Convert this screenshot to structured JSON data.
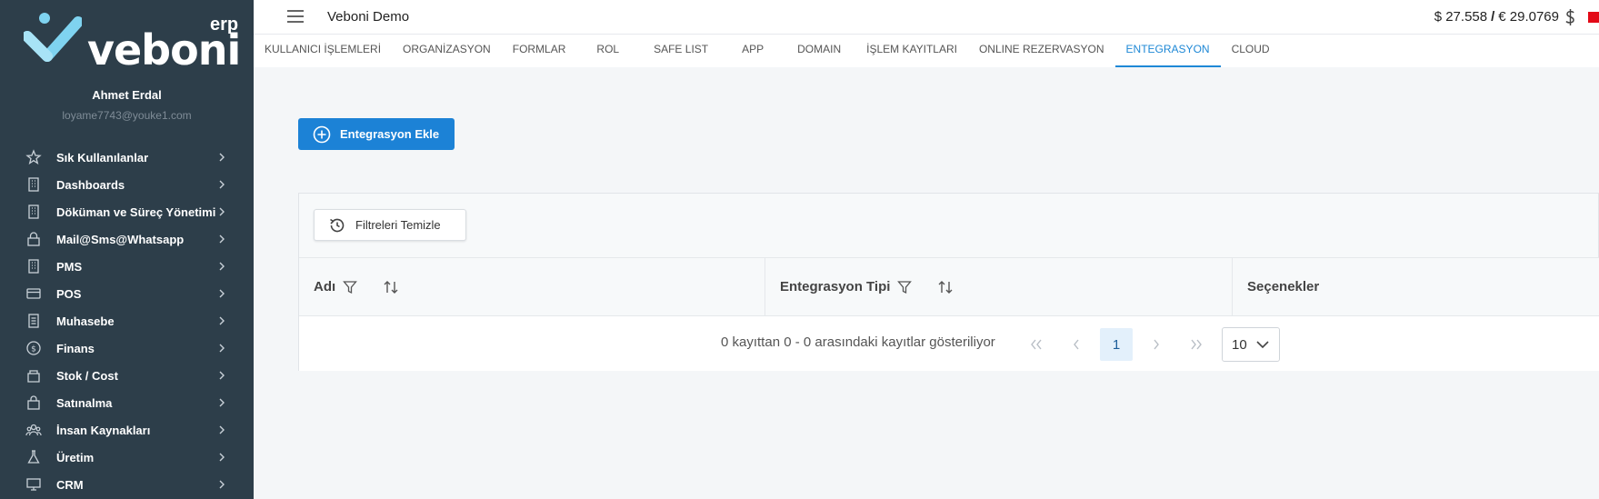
{
  "brand": {
    "logo_text": "veboni",
    "logo_suffix": "erp"
  },
  "user": {
    "name": "Ahmet Erdal",
    "email": "loyame7743@youke1.com"
  },
  "sidebar": {
    "items": [
      {
        "label": "Sık Kullanılanlar",
        "icon": "star-icon"
      },
      {
        "label": "Dashboards",
        "icon": "building-icon"
      },
      {
        "label": "Döküman ve Süreç Yönetimi",
        "icon": "building-icon"
      },
      {
        "label": "Mail@Sms@Whatsapp",
        "icon": "lock-icon"
      },
      {
        "label": "PMS",
        "icon": "building-icon"
      },
      {
        "label": "POS",
        "icon": "card-icon"
      },
      {
        "label": "Muhasebe",
        "icon": "ledger-icon"
      },
      {
        "label": "Finans",
        "icon": "dollar-circle-icon"
      },
      {
        "label": "Stok / Cost",
        "icon": "box-icon"
      },
      {
        "label": "Satınalma",
        "icon": "bag-icon"
      },
      {
        "label": "İnsan Kaynakları",
        "icon": "people-icon"
      },
      {
        "label": "Üretim",
        "icon": "flask-icon"
      },
      {
        "label": "CRM",
        "icon": "monitor-icon"
      }
    ]
  },
  "header": {
    "title": "Veboni Demo",
    "usd_rate": "$ 27.558",
    "separator": "/",
    "eur_rate": "€ 29.0769"
  },
  "tabs": [
    {
      "label": "KULLANICI İŞLEMLERİ",
      "active": false
    },
    {
      "label": "ORGANİZASYON",
      "active": false
    },
    {
      "label": "FORMLAR",
      "active": false
    },
    {
      "label": "ROL",
      "active": false
    },
    {
      "label": "SAFE LIST",
      "active": false
    },
    {
      "label": "APP",
      "active": false
    },
    {
      "label": "DOMAIN",
      "active": false
    },
    {
      "label": "İŞLEM KAYITLARI",
      "active": false
    },
    {
      "label": "ONLINE REZERVASYON",
      "active": false
    },
    {
      "label": "ENTEGRASYON",
      "active": true
    },
    {
      "label": "CLOUD",
      "active": false
    }
  ],
  "main": {
    "add_button_label": "Entegrasyon Ekle",
    "clear_filters_label": "Filtreleri Temizle",
    "columns": [
      {
        "label": "Adı"
      },
      {
        "label": "Entegrasyon Tipi"
      },
      {
        "label": "Seçenekler"
      }
    ],
    "pager": {
      "summary": "0 kayıttan 0 - 0 arasındaki kayıtlar gösteriliyor",
      "current_page": "1",
      "page_size": "10"
    }
  },
  "colors": {
    "sidebar_bg": "#2d3e4a",
    "accent": "#1c82d6",
    "active_tab": "#1e88d6",
    "flag": "#e30a17"
  }
}
